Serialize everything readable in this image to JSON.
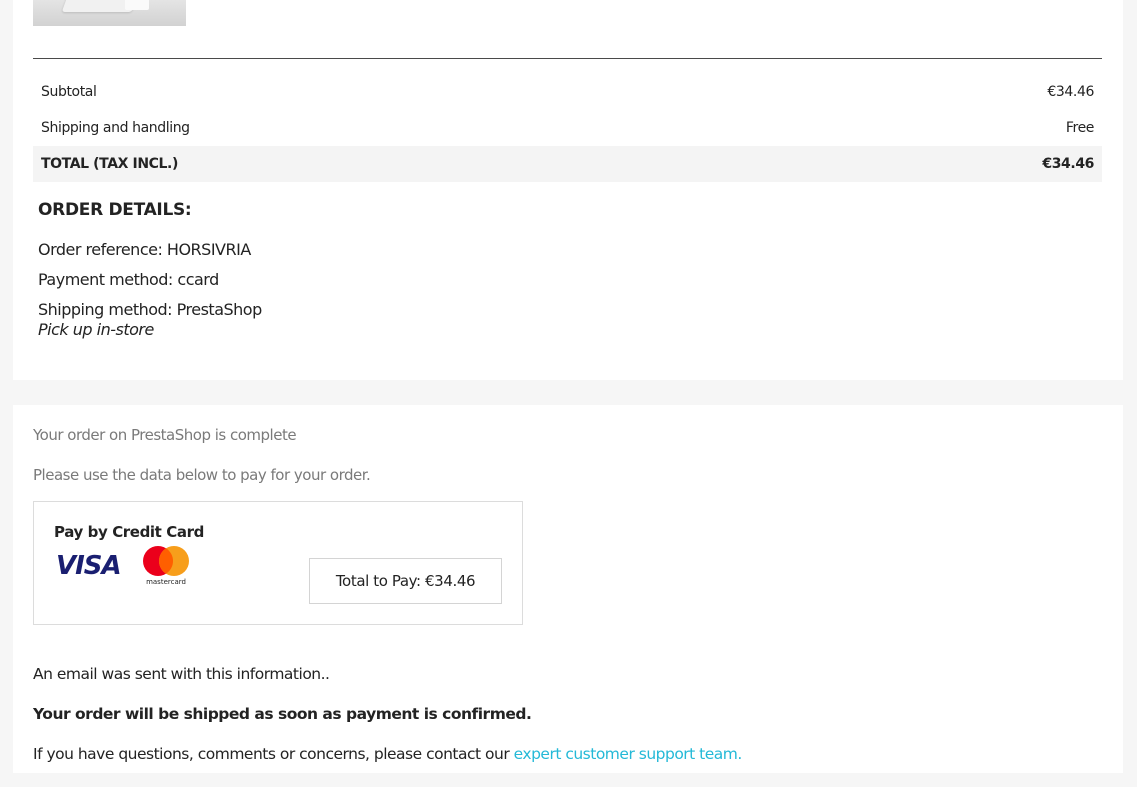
{
  "totals": {
    "subtotal_label": "Subtotal",
    "subtotal_value": "€34.46",
    "shipping_label": "Shipping and handling",
    "shipping_value": "Free",
    "total_label": "TOTAL (TAX INCL.)",
    "total_value": "€34.46"
  },
  "order_details": {
    "title": "ORDER DETAILS:",
    "reference": "Order reference: HORSIVRIA",
    "payment_method": "Payment method: ccard",
    "shipping_method": "Shipping method: PrestaShop",
    "carrier_delay": "Pick up in-store"
  },
  "payment": {
    "complete_text": "Your order on PrestaShop is complete",
    "instructions": "Please use the data below to pay for your order.",
    "box_title": "Pay by Credit Card",
    "visa_text": "VISA",
    "mastercard_text": "mastercard",
    "total_to_pay": "Total to Pay: €34.46"
  },
  "info": {
    "email_sent": "An email was sent with this information..",
    "ship_confirm": "Your order will be shipped as soon as payment is confirmed.",
    "questions_prefix": "If you have questions, comments or concerns, please contact our ",
    "support_link": "expert customer support team."
  },
  "colors": {
    "link": "#24b9d7",
    "visa_blue": "#1a1f71",
    "mc_red": "#eb001b",
    "mc_orange": "#f79e1b"
  }
}
